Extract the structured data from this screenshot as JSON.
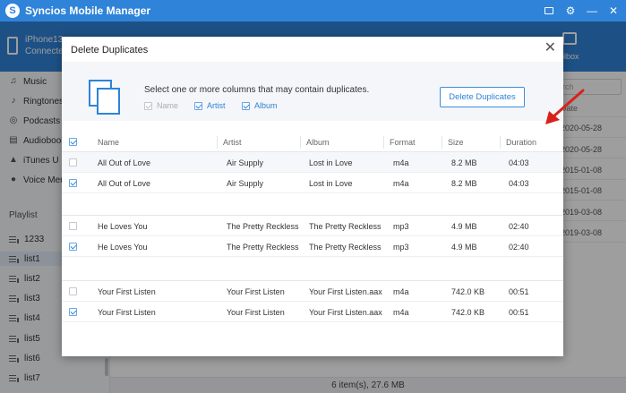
{
  "app": {
    "title": "Syncios Mobile Manager"
  },
  "device": {
    "name": "iPhone13,",
    "status": "Connecte"
  },
  "toolbox_label": "olbox",
  "sidebar": {
    "media": [
      {
        "label": "Music",
        "icon": "music-note-icon"
      },
      {
        "label": "Ringtones",
        "icon": "bell-icon"
      },
      {
        "label": "Podcasts",
        "icon": "podcast-icon"
      },
      {
        "label": "Audiobooks",
        "icon": "book-icon"
      },
      {
        "label": "iTunes U",
        "icon": "graduation-cap-icon"
      },
      {
        "label": "Voice Memos",
        "icon": "microphone-icon"
      }
    ],
    "playlist_header": "Playlist",
    "playlists": [
      "1233",
      "list1",
      "list2",
      "list3",
      "list4",
      "list5",
      "list6",
      "list7"
    ]
  },
  "main": {
    "search_placeholder": "rch",
    "date_header": "Date",
    "dates": [
      "2020-05-28",
      "2020-05-28",
      "2015-01-08",
      "2015-01-08",
      "2019-03-08",
      "2019-03-08"
    ]
  },
  "status": {
    "summary": "6 item(s), 27.6 MB"
  },
  "dialog": {
    "title": "Delete Duplicates",
    "close_label": "✕",
    "instruction": "Select one or more columns that may contain duplicates.",
    "columns": [
      {
        "label": "Name",
        "checked": true,
        "disabled": true
      },
      {
        "label": "Artist",
        "checked": true,
        "disabled": false
      },
      {
        "label": "Album",
        "checked": true,
        "disabled": false
      }
    ],
    "delete_button": "Delete Duplicates",
    "table": {
      "headers": [
        "Name",
        "Artist",
        "Album",
        "Format",
        "Size",
        "Duration"
      ],
      "rows": [
        {
          "checked": false,
          "name": "All Out of Love",
          "artist": "Air Supply",
          "album": "Lost in Love",
          "format": "m4a",
          "size": "8.2 MB",
          "duration": "04:03"
        },
        {
          "checked": true,
          "name": "All Out of Love",
          "artist": "Air Supply",
          "album": "Lost in Love",
          "format": "m4a",
          "size": "8.2 MB",
          "duration": "04:03"
        },
        {
          "checked": false,
          "name": "He Loves You",
          "artist": "The Pretty Reckless",
          "album": "The Pretty Reckless",
          "format": "mp3",
          "size": "4.9 MB",
          "duration": "02:40"
        },
        {
          "checked": true,
          "name": "He Loves You",
          "artist": "The Pretty Reckless",
          "album": "The Pretty Reckless",
          "format": "mp3",
          "size": "4.9 MB",
          "duration": "02:40"
        },
        {
          "checked": false,
          "name": "Your First Listen",
          "artist": "Your First Listen",
          "album": "Your First Listen.aax",
          "format": "m4a",
          "size": "742.0 KB",
          "duration": "00:51"
        },
        {
          "checked": true,
          "name": "Your First Listen",
          "artist": "Your First Listen",
          "album": "Your First Listen.aax",
          "format": "m4a",
          "size": "742.0 KB",
          "duration": "00:51"
        }
      ]
    }
  },
  "colors": {
    "accent": "#2f83d8",
    "annotation_arrow": "#d9211c"
  }
}
